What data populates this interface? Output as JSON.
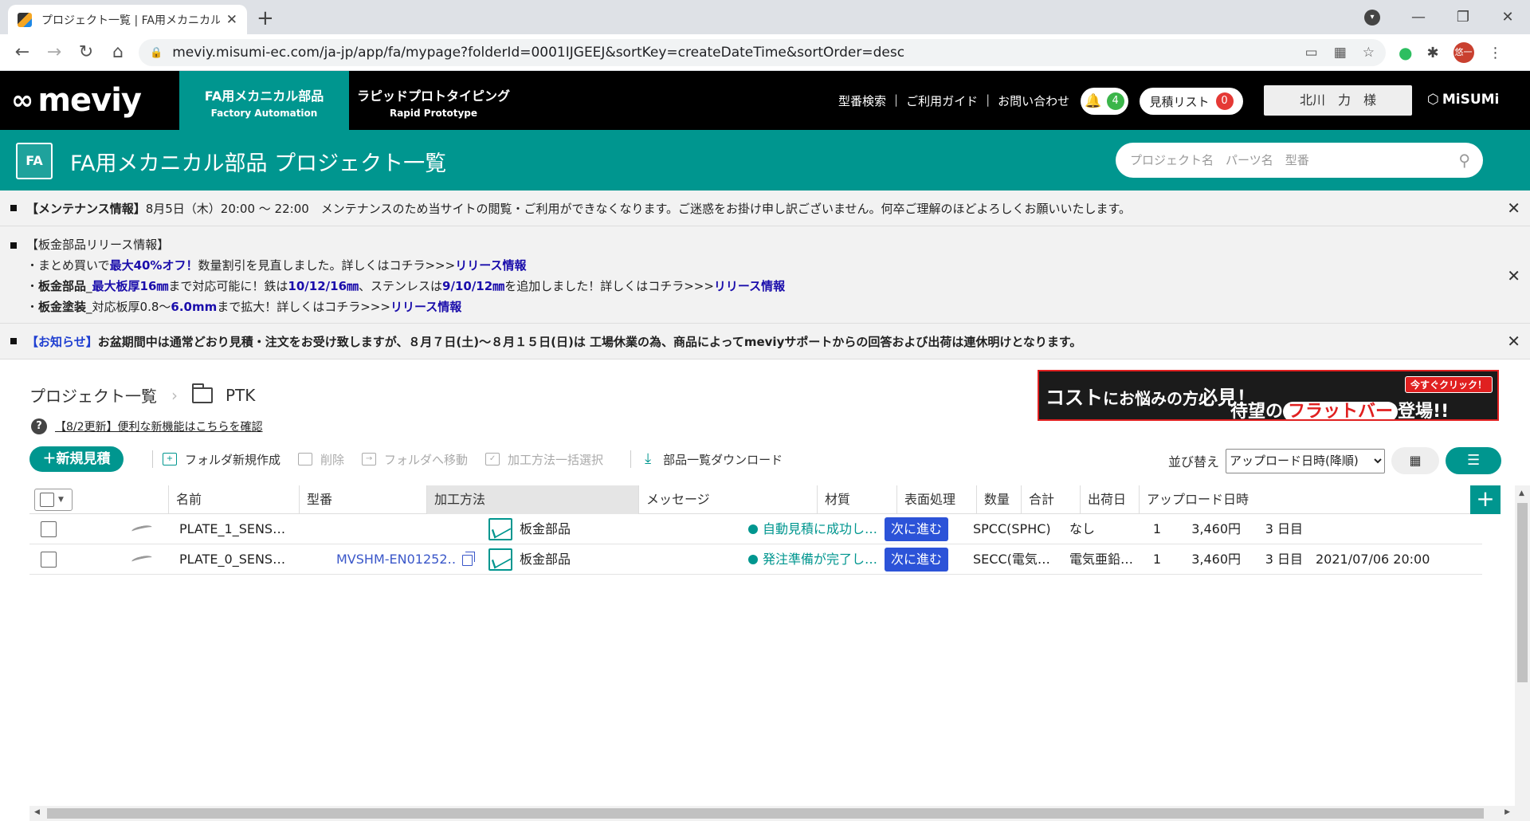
{
  "browser": {
    "tab_title": "プロジェクト一覧 | FA用メカニカル部品",
    "url": "meviy.misumi-ec.com/ja-jp/app/fa/mypage?folderId=0001IJGEEJ&sortKey=createDateTime&sortOrder=desc",
    "profile_initial": "悠一"
  },
  "header": {
    "logo": "meviy",
    "nav_fa_jp": "FA用メカニカル部品",
    "nav_fa_en": "Factory Automation",
    "nav_rp_jp": "ラピッドプロトタイピング",
    "nav_rp_en": "Rapid Prototype",
    "links": [
      "型番検索",
      "ご利用ガイド",
      "お問い合わせ"
    ],
    "notification_count": "4",
    "quote_list_label": "見積リスト",
    "quote_count": "0",
    "user_name": "北川　力　様",
    "brand": "MiSUMi",
    "accent_color": "#00968f"
  },
  "title_bar": {
    "icon_label": "FA",
    "title": "FA用メカニカル部品 プロジェクト一覧",
    "search_placeholder": "プロジェクト名　パーツ名　型番"
  },
  "notices": {
    "maintenance": {
      "head": "【メンテナンス情報】",
      "body": "8月5日（木）20:00 ～ 22:00　メンテナンスのため当サイトの閲覧・ご利用ができなくなります。ご迷惑をお掛け申し訳ございません。何卒ご理解のほどよろしくお願いいたします。"
    },
    "sheetmetal": {
      "head": "【板金部品リリース情報】",
      "line1_a": "・まとめ買いで",
      "line1_b": "最大40%オフ！",
      "line1_c": "数量割引を見直しました。詳しくはコチラ>>>",
      "line1_link": "リリース情報",
      "line2_a": "・",
      "line2_b": "板金部品",
      "line2_c": "_",
      "line2_d": "最大板厚16㎜",
      "line2_e": "まで対応可能に！鉄は",
      "line2_f": "10/12/16㎜",
      "line2_g": "、ステンレスは",
      "line2_h": "9/10/12㎜",
      "line2_i": "を追加しました！詳しくはコチラ>>>",
      "line2_link": "リリース情報",
      "line3_a": "・",
      "line3_b": "板金塗装",
      "line3_c": "_対応板厚0.8～",
      "line3_d": "6.0mm",
      "line3_e": "まで拡大！詳しくはコチラ>>>",
      "line3_link": "リリース情報"
    },
    "obon": {
      "head": "【お知らせ】",
      "body": "お盆期間中は通常どおり見積・注文をお受け致しますが、８月７日(土)～８月１５日(日)は 工場休業の為、商品によってmeviyサポートからの回答および出荷は連休明けとなります。"
    }
  },
  "breadcrumb": {
    "root": "プロジェクト一覧",
    "folder": "PTK"
  },
  "help_link": "【8/2更新】便利な新機能はこちらを確認",
  "banner": {
    "text1": "コスト",
    "text1b": "にお悩みの方",
    "text1c": "必見！",
    "text2a": "待望の",
    "text2b": "フラットバー",
    "text2c": "登場!!",
    "click": "今すぐクリック！"
  },
  "toolbar": {
    "new_quote": "＋新規見積",
    "new_folder": "フォルダ新規作成",
    "delete": "削除",
    "move_to_folder": "フォルダへ移動",
    "bulk_process": "加工方法一括選択",
    "download_list": "部品一覧ダウンロード",
    "sort_label": "並び替え",
    "sort_selected": "アップロード日時(降順)"
  },
  "table": {
    "columns": [
      "名前",
      "型番",
      "加工方法",
      "メッセージ",
      "材質",
      "表面処理",
      "数量",
      "合計",
      "出荷日",
      "アップロード日時"
    ],
    "next_label": "次に進む",
    "rows": [
      {
        "name": "PLATE_1_SENS…",
        "part_no": "",
        "process": "板金部品",
        "message": "自動見積に成功し…",
        "material": "SPCC(SPHC)",
        "surface": "なし",
        "qty": "1",
        "total": "3,460円",
        "ship": "3 日目",
        "uploaded": ""
      },
      {
        "name": "PLATE_0_SENS…",
        "part_no": "MVSHM-EN01252…",
        "process": "板金部品",
        "message": "発注準備が完了し…",
        "material": "SECC(電気…",
        "surface": "電気亜鉛…",
        "qty": "1",
        "total": "3,460円",
        "ship": "3 日目",
        "uploaded": "2021/07/06 20:00"
      }
    ]
  }
}
